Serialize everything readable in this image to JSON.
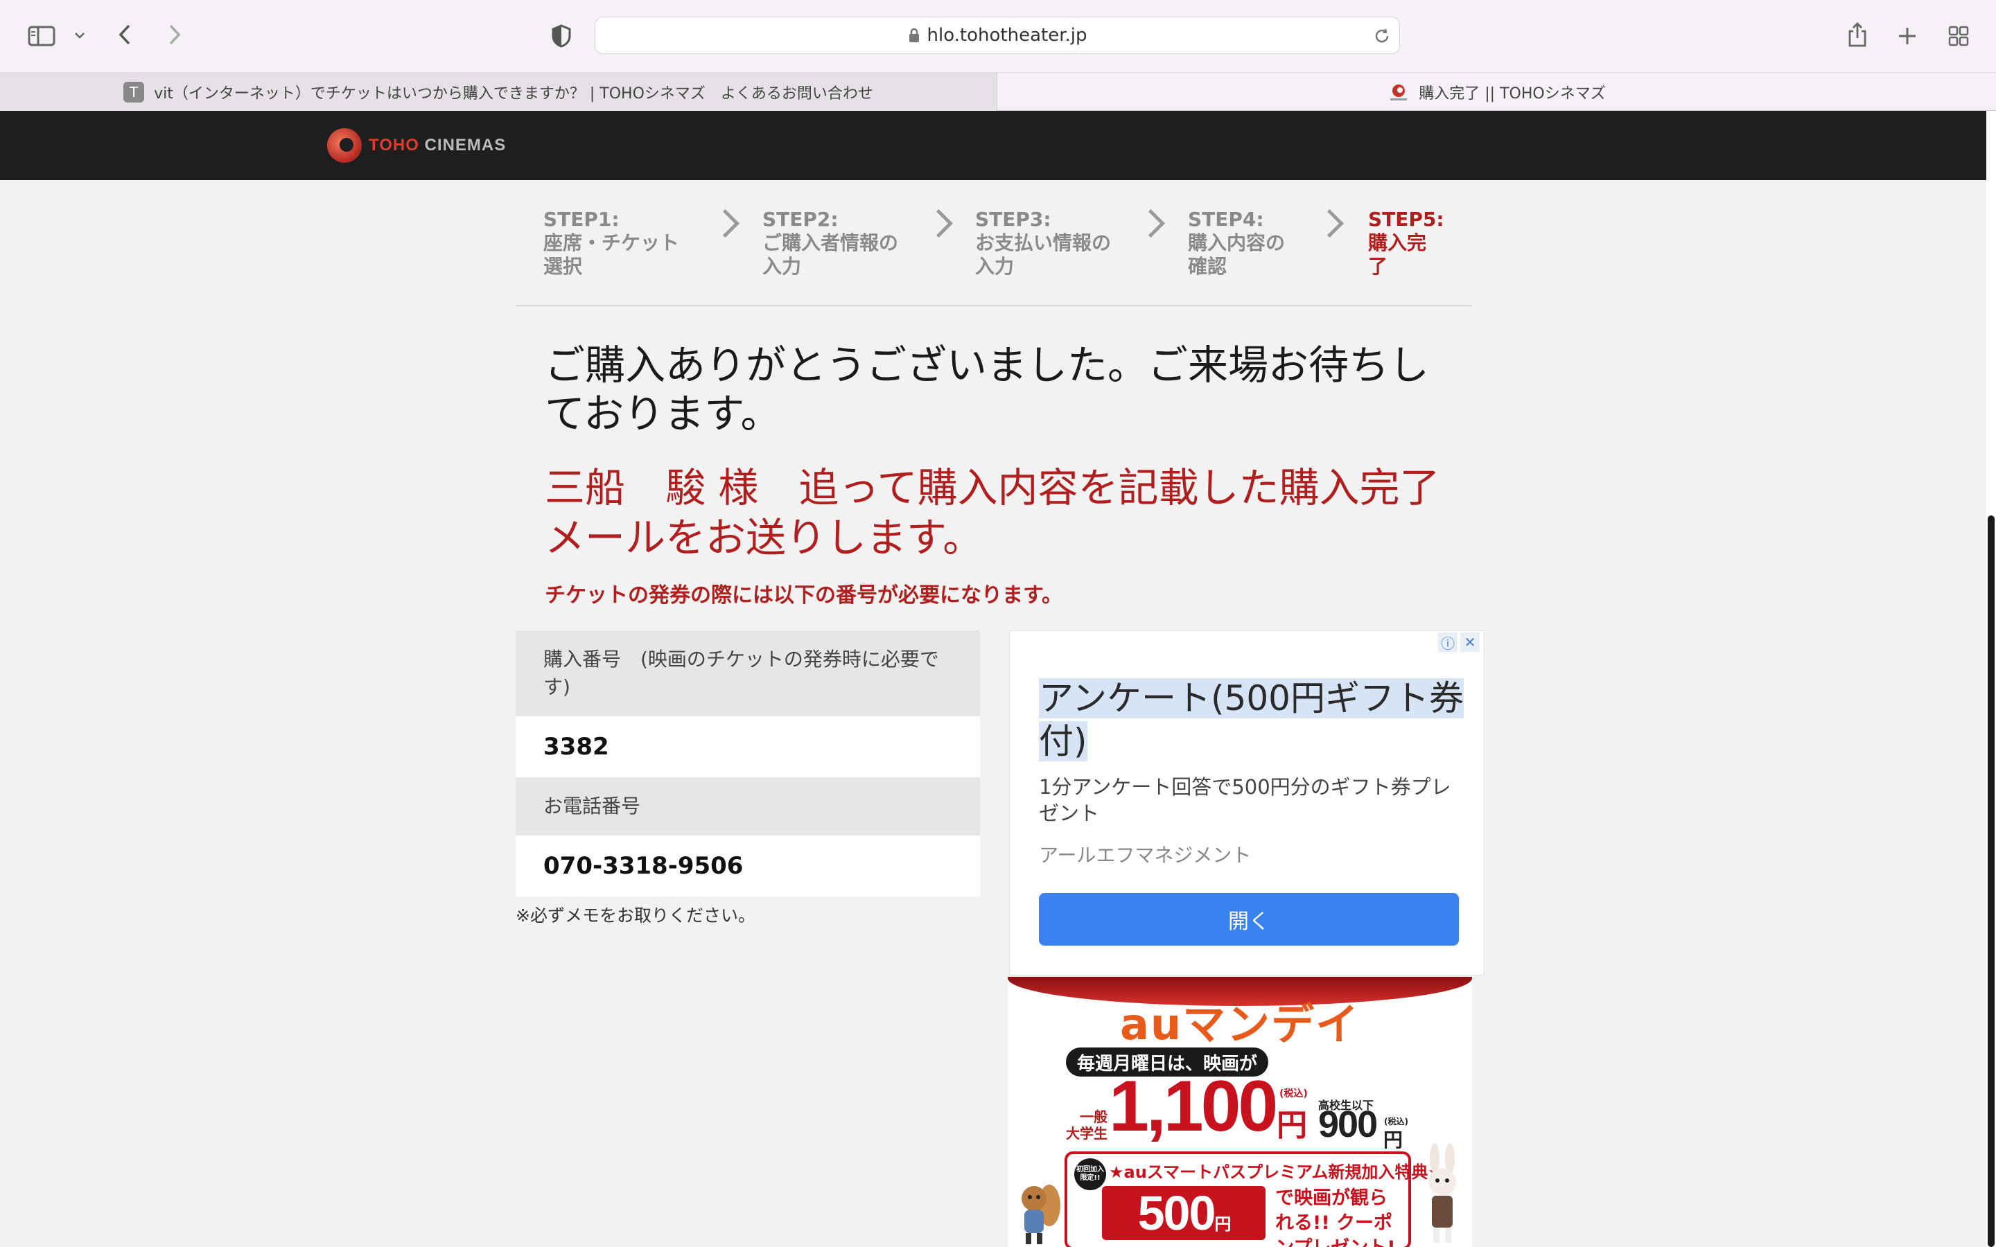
{
  "browser": {
    "url": "hlo.tohotheater.jp",
    "tabs": [
      {
        "favicon": "T",
        "title": "vit（インターネット）でチケットはいつから購入できますか？ | TOHOシネマズ　よくあるお問い合わせ"
      },
      {
        "title": "購入完了 || TOHOシネマズ"
      }
    ]
  },
  "site": {
    "logo_toho": "TOHO",
    "logo_cinemas": "CINEMAS"
  },
  "steps": [
    {
      "text": "STEP1:\n座席・チケット\n選択"
    },
    {
      "text": "STEP2:\nご購入者情報の\n入力"
    },
    {
      "text": "STEP3:\nお支払い情報の\n入力"
    },
    {
      "text": "STEP4:\n購入内容の\n確認"
    },
    {
      "text": "STEP5:\n購入完\n了"
    }
  ],
  "main": {
    "thanks": "ご購入ありがとうございました。ご来場お待ちしております。",
    "mail_message": "三船　駿 様　追って購入内容を記載した購入完了メールをお送りします。",
    "notice": "チケットの発券の際には以下の番号が必要になります。",
    "purchase_label": "購入番号　(映画のチケットの発券時に必要です)",
    "purchase_number": "3382",
    "phone_label": "お電話番号",
    "phone_number": "070-3318-9506",
    "memo": "※必ずメモをお取りください。"
  },
  "ad": {
    "title": "アンケート(500円ギフト券付)",
    "description": "1分アンケート回答で500円分のギフト券プレゼント",
    "advertiser": "アールエフマネジメント",
    "button": "開く",
    "info_icon": "ⓘ",
    "close_icon": "✕"
  },
  "banner": {
    "title": "auマンデイ",
    "subtitle": "毎週月曜日は、映画が",
    "general_label": "一般\n大学生",
    "price_general": "1,100",
    "yen": "円",
    "tax_in": "(税込)",
    "highschool_label": "高校生以下",
    "price_highschool": "900",
    "promo_title": "★auスマートパスプレミアム新規加入特典★",
    "limited": "初回加入\n限定!!",
    "promo_price": "500",
    "promo_text": "で映画が観られる!! クーポンプレゼント!"
  },
  "colors": {
    "accent_red": "#b01e1e",
    "header_bg": "#1e1e1e",
    "ad_button": "#3a82f0"
  }
}
